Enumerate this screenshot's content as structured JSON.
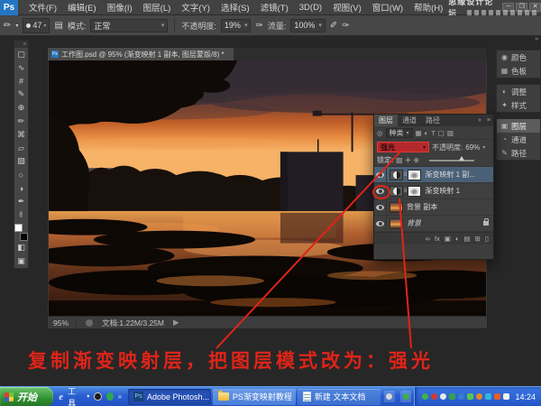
{
  "colors": {
    "annotation_red": "#e02418",
    "blend_highlight": "#b3292b",
    "selected_layer_row": "#4a6076",
    "xp_taskbar_blue": "#2a5fd0",
    "ps_logo_blue": "#2576c2"
  },
  "menu_bar": {
    "logo": "Ps",
    "items": [
      "文件(F)",
      "编辑(E)",
      "图像(I)",
      "图层(L)",
      "文字(Y)",
      "选择(S)",
      "滤镜(T)",
      "3D(D)",
      "视图(V)",
      "窗口(W)",
      "帮助(H)"
    ],
    "watermark": "思缘设计论坛",
    "win_min": "─",
    "win_restore": "❐",
    "win_close": "✕"
  },
  "options_bar": {
    "brush_preset_size": "47",
    "mode_label": "模式:",
    "mode_value": "正常",
    "opacity_label": "不透明度:",
    "opacity_value": "19%",
    "flow_label": "流量:",
    "flow_value": "100%",
    "dd_arrow": "▾"
  },
  "toolbar": {
    "collapse_glyph": "»",
    "tools": [
      {
        "name": "marquee",
        "glyph": "▢"
      },
      {
        "name": "lasso",
        "glyph": "∿"
      },
      {
        "name": "crop",
        "glyph": "#"
      },
      {
        "name": "eyedropper",
        "glyph": "✎"
      },
      {
        "name": "healing-brush",
        "glyph": "⊕"
      },
      {
        "name": "brush",
        "glyph": "✏"
      },
      {
        "name": "clone-stamp",
        "glyph": "⌘"
      },
      {
        "name": "eraser",
        "glyph": "▱"
      },
      {
        "name": "gradient",
        "glyph": "▨"
      },
      {
        "name": "blur",
        "glyph": "○"
      },
      {
        "name": "dodge",
        "glyph": "◑"
      },
      {
        "name": "pen",
        "glyph": "✒"
      },
      {
        "name": "hand",
        "glyph": "✌"
      }
    ],
    "quickmask_glyph": "◧",
    "screenmode_glyph": "▣"
  },
  "document": {
    "tab_title": "工作图.psd @ 95% (渐变映射 1 副本, 图层蒙版/8) *",
    "tab_icon": "Ps",
    "status_zoom": "95%",
    "status_doc": "文档:1.22M/3.25M",
    "status_arrow": "▶"
  },
  "dock": {
    "collapse_glyph": "»",
    "items": [
      {
        "label": "颜色",
        "glyph": "◉"
      },
      {
        "label": "色板",
        "glyph": "▦"
      },
      {
        "label": "调整",
        "glyph": "◐"
      },
      {
        "label": "样式",
        "glyph": "✦"
      },
      {
        "label": "图层",
        "glyph": "▣"
      },
      {
        "label": "通道",
        "glyph": "◔"
      },
      {
        "label": "路径",
        "glyph": "✎"
      }
    ]
  },
  "layers_panel": {
    "tabs": [
      "图层",
      "通道",
      "路径"
    ],
    "collapse_glyph": "»",
    "menu_glyph": "≡",
    "filter_prefix": "◎",
    "filter_label": "种类",
    "filter_arrow": "▾",
    "filter_icons": [
      "▦",
      "◐",
      "T",
      "▢",
      "▧"
    ],
    "blend_value": "强光",
    "blend_arrow": "▾",
    "opacity_label": "不透明度:",
    "opacity_value": "69%",
    "opacity_arrow": "▾",
    "lock_label": "锁定:",
    "lock_icons": [
      "▨",
      "✛",
      "⊕"
    ],
    "link_glyph": "8",
    "rows": [
      {
        "name": "渐变映射 1 副..."
      },
      {
        "name": "渐变映射 1"
      },
      {
        "name": "背景 副本"
      },
      {
        "name": "背景"
      }
    ],
    "bottom_icons": [
      "∞",
      "fx",
      "▣",
      "◐",
      "▤",
      "⊞",
      "▯"
    ]
  },
  "annotation": {
    "text": "复制渐变映射层，把图层模式改为：强光"
  },
  "taskbar": {
    "start_label": "开始",
    "ie_glyph": "e",
    "tools_label": "工具",
    "tools_arrow": "▾",
    "chevron": "»",
    "tasks": [
      "Adobe Photosh...",
      "PS渐变映射教程",
      "新建 文本文档"
    ],
    "clock": "14:24"
  }
}
